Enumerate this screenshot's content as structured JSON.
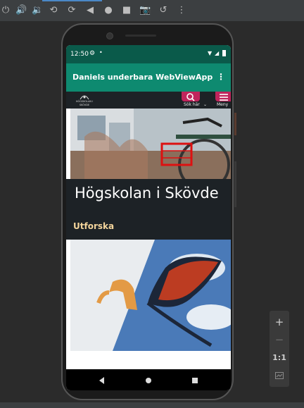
{
  "emulator": {
    "toolbar_icons": [
      "power-icon",
      "volume-up-icon",
      "volume-down-icon",
      "rotate-left-icon",
      "rotate-right-icon",
      "back-icon",
      "home-icon",
      "overview-icon",
      "screenshot-icon",
      "snapshot-icon",
      "more-vert-icon"
    ],
    "zoom": {
      "plus": "+",
      "minus": "−",
      "one_to_one": "1:1",
      "fit_icon": "fit-screen-icon"
    }
  },
  "status_bar": {
    "time": "12:50"
  },
  "app_bar": {
    "title": "Daniels underbara WebViewApp",
    "overflow": "⋮"
  },
  "site_header": {
    "search_label": "Sök här",
    "menu_label": "Meny",
    "logo_text": "HÖGSKOLAN I SKÖVDE"
  },
  "hero": {
    "title": "Högskolan i Skövde"
  },
  "section": {
    "label": "Utforska"
  },
  "colors": {
    "status_bar": "#0a5a4a",
    "app_bar": "#0e8a70",
    "accent": "#c0245c",
    "site_dark": "#1d2226",
    "section_label": "#f3d49b"
  }
}
